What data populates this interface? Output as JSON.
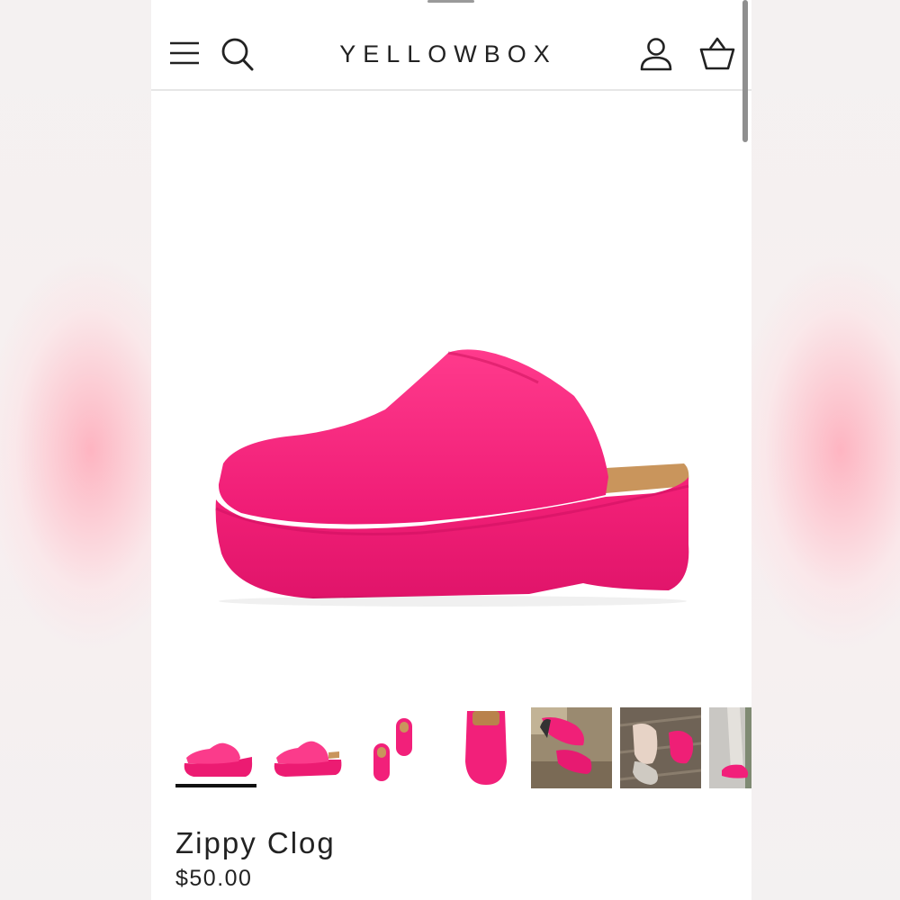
{
  "header": {
    "brand": "YELLOWBOX",
    "icons": [
      "menu-icon",
      "search-icon",
      "account-icon",
      "basket-icon"
    ]
  },
  "product": {
    "title": "Zippy Clog",
    "price": "$50.00",
    "color": "#f21f7a"
  },
  "gallery": {
    "selected_index": 0,
    "thumbnail_count": 7
  }
}
